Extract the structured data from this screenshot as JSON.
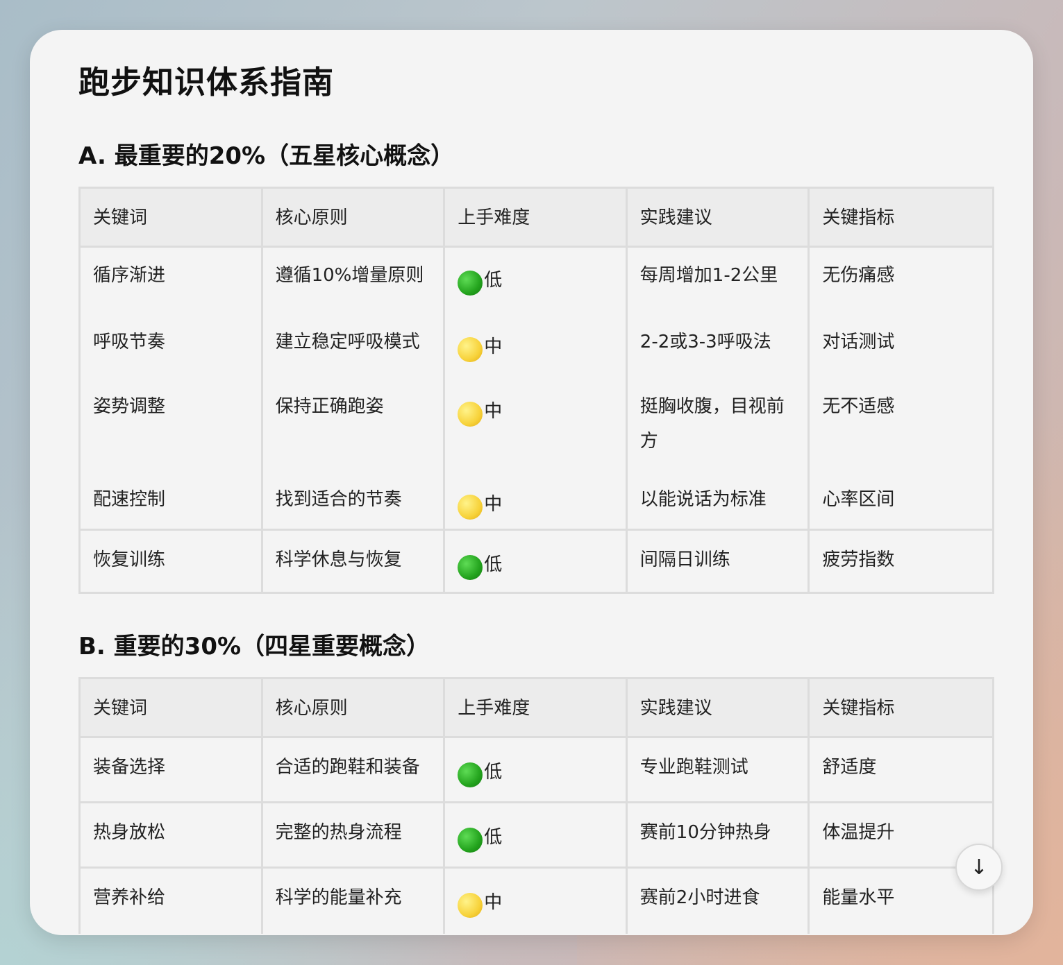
{
  "page": {
    "title": "跑步知识体系指南"
  },
  "section_a": {
    "title": "A. 最重要的20%（五星核心概念）",
    "headers": [
      "关键词",
      "核心原则",
      "上手难度",
      "实践建议",
      "关键指标"
    ],
    "rows": [
      {
        "keyword": "循序渐进",
        "principle": "遵循10%增量原则",
        "difficulty": "低",
        "difficulty_icon": "green-circle",
        "advice": "每周增加1-2公里",
        "metric": "无伤痛感"
      },
      {
        "keyword": "呼吸节奏",
        "principle": "建立稳定呼吸模式",
        "difficulty": "中",
        "difficulty_icon": "yellow-circle",
        "advice": "2-2或3-3呼吸法",
        "metric": "对话测试"
      },
      {
        "keyword": "姿势调整",
        "principle": "保持正确跑姿",
        "difficulty": "中",
        "difficulty_icon": "yellow-circle",
        "advice": "挺胸收腹，目视前方",
        "metric": "无不适感"
      },
      {
        "keyword": "配速控制",
        "principle": "找到适合的节奏",
        "difficulty": "中",
        "difficulty_icon": "yellow-circle",
        "advice": "以能说话为标准",
        "metric": "心率区间"
      },
      {
        "keyword": "恢复训练",
        "principle": "科学休息与恢复",
        "difficulty": "低",
        "difficulty_icon": "green-circle",
        "advice": "间隔日训练",
        "metric": "疲劳指数"
      }
    ]
  },
  "section_b": {
    "title": "B. 重要的30%（四星重要概念）",
    "headers": [
      "关键词",
      "核心原则",
      "上手难度",
      "实践建议",
      "关键指标"
    ],
    "rows": [
      {
        "keyword": "装备选择",
        "principle": "合适的跑鞋和装备",
        "difficulty": "低",
        "difficulty_icon": "green-circle",
        "advice": "专业跑鞋测试",
        "metric": "舒适度"
      },
      {
        "keyword": "热身放松",
        "principle": "完整的热身流程",
        "difficulty": "低",
        "difficulty_icon": "green-circle",
        "advice": "赛前10分钟热身",
        "metric": "体温提升"
      },
      {
        "keyword": "营养补给",
        "principle": "科学的能量补充",
        "difficulty": "中",
        "difficulty_icon": "yellow-circle",
        "advice": "赛前2小时进食",
        "metric": "能量水平"
      }
    ]
  },
  "scroll_button": {
    "icon": "arrow-down-icon",
    "glyph": "↓"
  },
  "colors": {
    "green_circle": "#23a31d",
    "yellow_circle": "#f7d23a",
    "header_bg": "#ececec",
    "card_bg": "#f4f4f4"
  }
}
